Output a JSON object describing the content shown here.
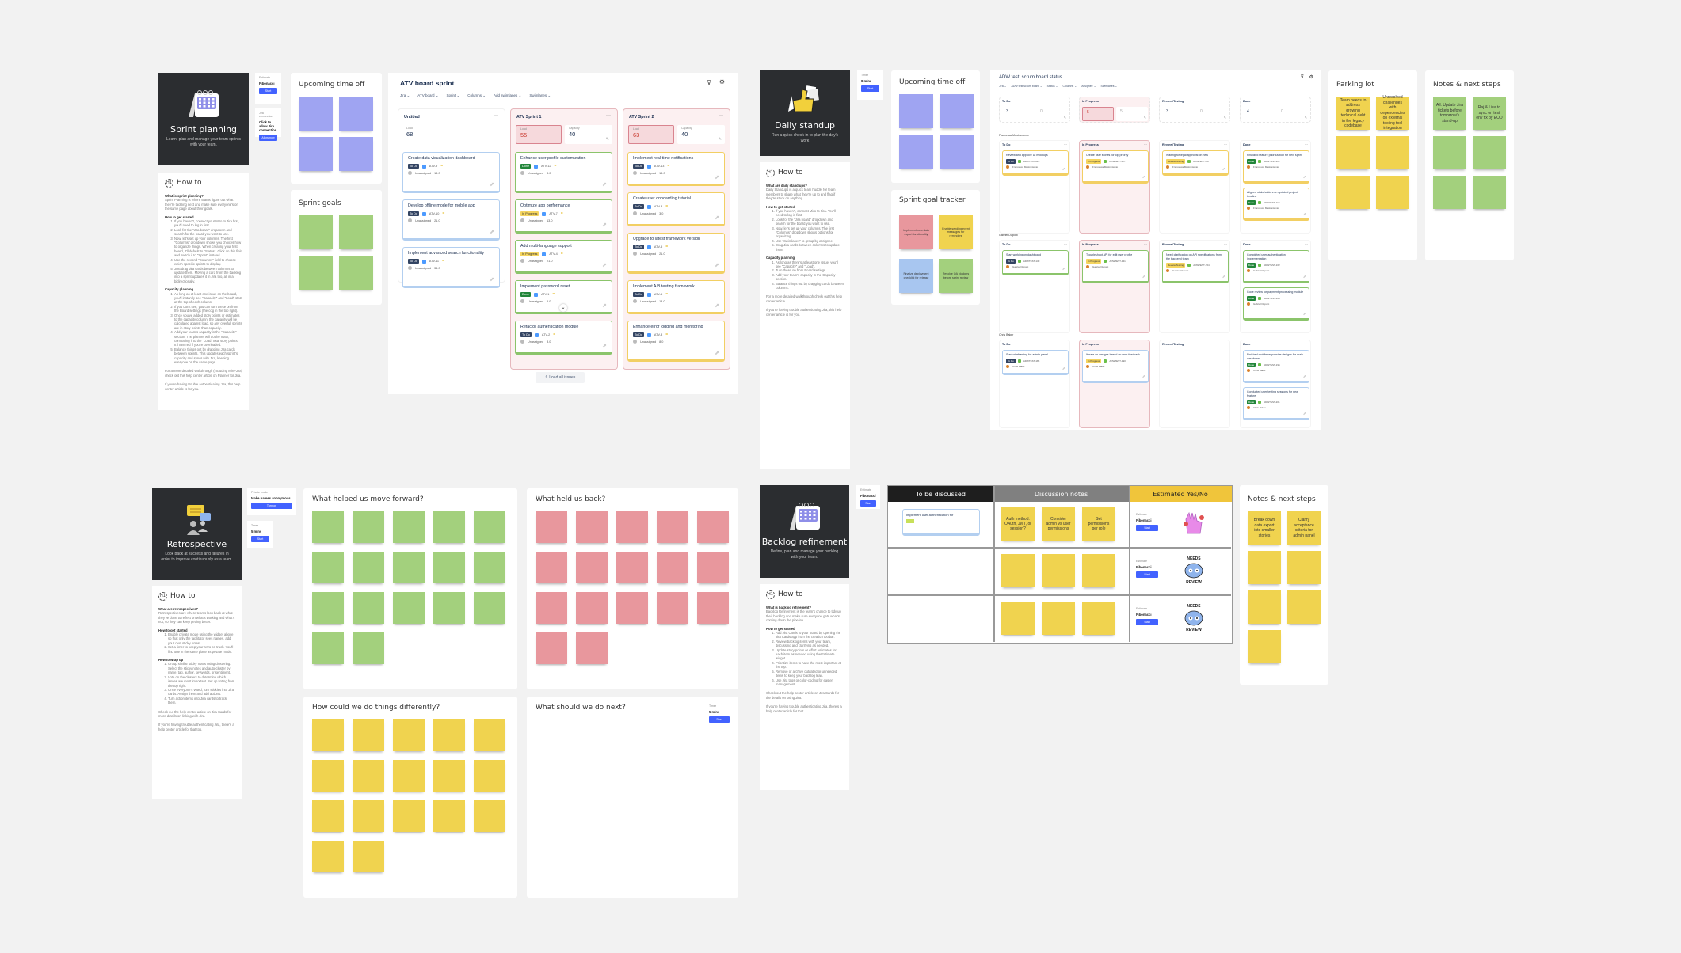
{
  "sprint_planning": {
    "hero": {
      "title": "Sprint planning",
      "subtitle": "Learn, plan and manage your team sprints with your team."
    },
    "estimate_widget": {
      "label": "Estimate",
      "value": "Fibonacci",
      "button": "Start"
    },
    "jira_widget": {
      "label": "Jira connection",
      "value": "Click to allow Jira connection",
      "button": "Allow now"
    },
    "howto": {
      "title": "How to",
      "sections": [
        {
          "heading": "What is sprint planning?",
          "body": "Sprint Planning is where teams figure out what they're tackling next and make sure everyone's on the same page about their goals."
        },
        {
          "heading": "How to get started",
          "items": [
            "If you haven't, connect your Miro to Jira first, you'll need to log in first.",
            "Look for the \"Jira board\" dropdown and search for the board you want to use.",
            "Now, let's set up your columns. The first \"Columns\" dropdown shows you choices how to organize things. When creating your first board, it'll default to \"Status\". Click on this field and switch it to \"Sprint\" instead.",
            "Use the second \"Columns\" field to choose which specific sprints to display.",
            "Just drag Jira cards between columns to update them. Moving a card from the backlog into a sprint updates it in Jira too, all in a bidirectionally."
          ]
        },
        {
          "heading": "Capacity planning",
          "items": [
            "As long as at least one issue on the board, you'll instantly see \"Capacity\" and \"Load\" stats at the top of each column.",
            "If you don't see, you can turn these on from the Board settings (the cog in the top right).",
            "Once you've added story points or estimates to the capacity column, the capacity will be calculated against load, so any overfull sprints are in story points than capacity.",
            "Add your team's capacity in the \"Capacity\" section. The planner will do the math, comparing it to the \"Load\" total story points. It'll turn red if you're overloaded.",
            "Balance things out by dragging Jira cards between sprints. This updates each sprint's capacity and syncs with Jira, keeping everyone on the same page."
          ]
        }
      ],
      "footer_links": [
        "For a more detailed walkthrough (including Miro-Jira) check out this help center article on Planner for Jira.",
        "If you're having trouble authenticating Jira, this help center article is for you."
      ]
    },
    "upcoming_time_off": {
      "title": "Upcoming time off",
      "sticky_count": 4
    },
    "sprint_goals": {
      "title": "Sprint goals",
      "sticky_count": 4
    },
    "board": {
      "title": "ATV board sprint",
      "toolbar": [
        "Jira",
        "ATV board",
        "Sprint",
        "Columns",
        "Add swimlanes",
        "Swimlanes"
      ],
      "columns": [
        {
          "name": "Untitled",
          "load_label": "Load",
          "load": "68",
          "capacity_label": null,
          "capacity": null,
          "cards": [
            {
              "title": "Create data visualization dashboard",
              "status": "To Do",
              "key": "ATV-9",
              "assignee": "Unassigned",
              "points": "13.0"
            },
            {
              "title": "Develop offline mode for mobile app",
              "status": "To Do",
              "key": "ATV-10",
              "assignee": "Unassigned",
              "points": "21.0"
            },
            {
              "title": "Implement advanced search functionality",
              "status": "To Do",
              "key": "ATV-11",
              "assignee": "Unassigned",
              "points": "34.0"
            }
          ]
        },
        {
          "name": "ATV Sprint 1",
          "load_label": "Load",
          "load": "55",
          "capacity_label": "Capacity",
          "capacity": "40",
          "cards": [
            {
              "title": "Enhance user profile customization",
              "status": "Done",
              "key": "ATV-12",
              "assignee": "Unassigned",
              "points": "8.0"
            },
            {
              "title": "Optimize app performance",
              "status": "In Progress",
              "key": "ATV-7",
              "assignee": "Unassigned",
              "points": "13.0"
            },
            {
              "title": "Add multi-language support",
              "status": "In Progress",
              "key": "ATV-4",
              "assignee": "Unassigned",
              "points": "21.0"
            },
            {
              "title": "Implement password reset",
              "status": "Done",
              "key": "ATV-1",
              "assignee": "Unassigned",
              "points": "5.0"
            },
            {
              "title": "Refactor authentication module",
              "status": "To Do",
              "key": "ATV-2",
              "assignee": "Unassigned",
              "points": "8.0"
            }
          ]
        },
        {
          "name": "ATV Sprint 2",
          "load_label": "Load",
          "load": "63",
          "capacity_label": "Capacity",
          "capacity": "40",
          "cards": [
            {
              "title": "Implement real-time notifications",
              "status": "To Do",
              "key": "ATV-13",
              "assignee": "Unassigned",
              "points": "13.0"
            },
            {
              "title": "Create user onboarding tutorial",
              "status": "To Do",
              "key": "ATV-3",
              "assignee": "Unassigned",
              "points": "3.0"
            },
            {
              "title": "Upgrade to latest framework version",
              "status": "To Do",
              "key": "ATV-5",
              "assignee": "Unassigned",
              "points": "21.0"
            },
            {
              "title": "Implement A/B testing framework",
              "status": "To Do",
              "key": "ATV-6",
              "assignee": "Unassigned",
              "points": "13.0"
            },
            {
              "title": "Enhance error logging and monitoring",
              "status": "To Do",
              "key": "ATV-8",
              "assignee": "Unassigned",
              "points": "8.0"
            }
          ]
        }
      ],
      "load_all_label": "Load all issues"
    }
  },
  "daily_standup": {
    "hero": {
      "title": "Daily standup",
      "subtitle": "Run a quick check-in to plan the day's work"
    },
    "timer_widget": {
      "label": "Timer",
      "value": "8 mins",
      "button": "Start"
    },
    "howto": {
      "title": "How to",
      "sections": [
        {
          "heading": "What are daily stand ups?",
          "body": "Daily Standups is a quick team huddle for team members to share what they're up to and flag if they're stuck on anything."
        },
        {
          "heading": "How to get started",
          "items": [
            "If you haven't, connect Miro to Jira. You'll need to log in first.",
            "Look for the \"Jira board\" dropdown and search for the board you want to use.",
            "Now, let's set up your columns. The first \"Columns\" dropdown shows options for organizing.",
            "Use \"Swimlanes\" to group by assignee.",
            "Drag Jira cards between columns to update them."
          ]
        },
        {
          "heading": "Capacity planning",
          "items": [
            "As long as there's at least one issue, you'll see \"Capacity\" and \"Load\".",
            "Turn these on from Board settings.",
            "Add your team's capacity in the Capacity section.",
            "Balance things out by dragging cards between columns."
          ]
        }
      ],
      "footer_links": [
        "For a more detailed walkthrough check out this help center article.",
        "If you're having trouble authenticating Jira, this help center article is for you."
      ]
    },
    "upcoming_time_off": {
      "title": "Upcoming time off",
      "sticky_count": 4
    },
    "sprint_goal_tracker": {
      "title": "Sprint goal tracker",
      "stickies": [
        {
          "text": "Implement new data export functionality",
          "color": "red"
        },
        {
          "text": "Enable sending event messages for reminders",
          "color": "yellow"
        },
        {
          "text": "Finalize deployment checklist for release",
          "color": "blue"
        },
        {
          "text": "Resolve QA blockers before sprint review",
          "color": "green"
        }
      ]
    },
    "board": {
      "title": "ADW test: scrum board status",
      "toolbar": [
        "Jira",
        "ADW test scrum board",
        "Status",
        "Columns",
        "Assignee",
        "Swimlanes"
      ],
      "summary": [
        {
          "name": "To Do",
          "load": "3",
          "capacity": "0"
        },
        {
          "name": "In Progress",
          "load": "5",
          "capacity": "5",
          "over": true
        },
        {
          "name": "Review/Testing",
          "load": "3",
          "capacity": "0"
        },
        {
          "name": "Done",
          "load": "4",
          "capacity": "0"
        }
      ],
      "swimlanes": [
        {
          "name": "Francesca Mastrantonio",
          "color": "y",
          "columns": [
            [
              {
                "title": "Review and approve UI mockups",
                "status": "To Do",
                "key": "ADWTEST-229"
              }
            ],
            [
              {
                "title": "Create user stories for top priority",
                "status": "In Progress",
                "key": "ADWTEST-177"
              }
            ],
            [
              {
                "title": "Waiting for legal approval on new",
                "status": "Review/Testing",
                "key": "ADWTEST-207"
              }
            ],
            [
              {
                "title": "Finalized feature prioritization for next sprint",
                "status": "Done",
                "key": "ADWTEST-113"
              },
              {
                "title": "Aligned stakeholders on updated project timeline",
                "status": "Done",
                "key": "ADWTEST-119"
              }
            ]
          ]
        },
        {
          "name": "Gabriel Dupont",
          "color": "g",
          "columns": [
            [
              {
                "title": "Start working on dashboard",
                "status": "To Do",
                "key": "ADWTEST-130"
              }
            ],
            [
              {
                "title": "Troubleshoot API for edit user profile",
                "status": "In Progress",
                "key": "ADWTEST-141"
              }
            ],
            [
              {
                "title": "Need clarification on API specifications from the backend team",
                "status": "Review/Testing",
                "key": "ADWTEST-154"
              }
            ],
            [
              {
                "title": "Completed user authentication implementation",
                "status": "Done",
                "key": "ADWTEST-162"
              },
              {
                "title": "Code review for payment processing module",
                "status": "Done",
                "key": "ADWTEST-168"
              }
            ]
          ]
        },
        {
          "name": "Chris Baker",
          "color": "b",
          "columns": [
            [
              {
                "title": "Start wireframing for admin panel",
                "status": "To Do",
                "key": "ADWTEST-185"
              }
            ],
            [
              {
                "title": "Iterate on designs based on user feedback",
                "status": "In Progress",
                "key": "ADWTEST-190"
              }
            ],
            [],
            [
              {
                "title": "Finished mobile responsive designs for main dashboard",
                "status": "Done",
                "key": "ADWTEST-196"
              },
              {
                "title": "Conducted user testing sessions for new feature",
                "status": "Done",
                "key": "ADWTEST-201"
              }
            ]
          ]
        }
      ]
    },
    "parking_lot": {
      "title": "Parking lot",
      "stickies": [
        "Team needs to address growing technical debt in the legacy codebase",
        "Unresolved challenges with dependencies on external testing tool integration",
        "",
        "",
        "",
        ""
      ]
    },
    "notes": {
      "title": "Notes & next steps",
      "stickies": [
        "All: Update Jira tickets before tomorrow's stand-up",
        "Raj & Lisa to sync on test env fix by EOD",
        "",
        "",
        "",
        ""
      ]
    }
  },
  "retrospective": {
    "hero": {
      "title": "Retrospective",
      "subtitle": "Look back at success and failures in order to improve continuously as a team."
    },
    "private_widget": {
      "label": "Private mode",
      "value": "Make names anonymous",
      "button": "Turn on"
    },
    "timer_widget": {
      "label": "Timer",
      "value": "5 mins",
      "button": "Start"
    },
    "howto": {
      "title": "How to",
      "sections": [
        {
          "heading": "What are retrospectives?",
          "body": "Retrospectives are where teams look back at what they've done to reflect on what's working and what's not, so they can keep getting better."
        },
        {
          "heading": "How to get started",
          "items": [
            "Enable private mode using the widget above so that only the facilitator sees names, add your own sticky notes.",
            "Set a timer to keep your retro on track. You'll find one in the same place as private mode."
          ]
        },
        {
          "heading": "How to wrap up",
          "items": [
            "Group similar sticky notes using clustering. Select the sticky notes and auto-cluster by name, tag, author, keywords, or sentiment.",
            "Vote on the clusters to determine which issues are most important. Set up voting from the top right.",
            "Once everyone's voted, turn stickies into Jira cards. Assign them and add actions.",
            "Turn action items into Jira cards to track them."
          ]
        }
      ],
      "footer_links": [
        "Check out the help center article on Jira Cards for more details on linking with Jira.",
        "If you're having trouble authenticating Jira, there's a help center article for that too."
      ]
    },
    "quadrants": [
      {
        "title": "What helped us move forward?",
        "color": "green",
        "count": 17
      },
      {
        "title": "What held us back?",
        "color": "red",
        "count": 17
      },
      {
        "title": "How could we do things differently?",
        "color": "yellow",
        "count": 17
      },
      {
        "title": "What should we do next?",
        "color": "none",
        "count": 0
      }
    ],
    "next_timer": {
      "label": "Timer",
      "value": "5 mins",
      "button": "Start"
    }
  },
  "backlog_refinement": {
    "hero": {
      "title": "Backlog refinement",
      "subtitle": "Define, plan and manage your backlog with your team."
    },
    "estimate_widget": {
      "label": "Estimate",
      "value": "Fibonacci",
      "button": "Start"
    },
    "howto": {
      "title": "How to",
      "sections": [
        {
          "heading": "What is backlog refinement?",
          "body": "Backlog Refinement is the team's chance to tidy up their backlog and make sure everyone gets what's coming down the pipeline."
        },
        {
          "heading": "How to get started",
          "items": [
            "Add Jira Cards to your board by opening the Jira Cards app from the creation toolbar.",
            "Review backlog items with your team, discussing and clarifying as needed.",
            "Update story points or effort estimates for each item as needed using the Estimate widget.",
            "Prioritize items to have the most important at the top.",
            "Remove or archive outdated or unneeded items to keep your backlog lean.",
            "Use Jira tags or color-coding for easier management."
          ]
        }
      ],
      "footer_links": [
        "Check out the help center article on Jira Cards for the details on using Jira.",
        "If you're having trouble authenticating Jira, there's a help center article for that."
      ]
    },
    "table": {
      "headers": [
        "To be discussed",
        "Discussion notes",
        "Estimated Yes/No"
      ],
      "rows": [
        {
          "item": "Implement user authentication for",
          "notes": [
            "Auth method: OAuth, JWT, or session?",
            "Consider admin vs user permissions",
            "Set permissions per role"
          ],
          "estimate": {
            "label": "Estimate",
            "value": "Fibonacci",
            "button": "Start"
          },
          "sticker": "thumbs-up-hand-sticker"
        },
        {
          "item": "",
          "notes": [
            "",
            "",
            ""
          ],
          "estimate": {
            "label": "Estimate",
            "value": "Fibonacci",
            "button": "Start"
          },
          "sticker": "needs-review-sticker",
          "sticker_text": "NEEDS REVIEW"
        },
        {
          "item": "",
          "notes": [
            "",
            "",
            ""
          ],
          "estimate": {
            "label": "Estimate",
            "value": "Fibonacci",
            "button": "Start"
          },
          "sticker": "needs-review-sticker",
          "sticker_text": "NEEDS REVIEW"
        }
      ]
    },
    "notes": {
      "title": "Notes & next steps",
      "stickies": [
        "Break down data export into smaller stories",
        "Clarify acceptance criteria for admin panel",
        "",
        "",
        "",
        "",
        ""
      ]
    }
  }
}
